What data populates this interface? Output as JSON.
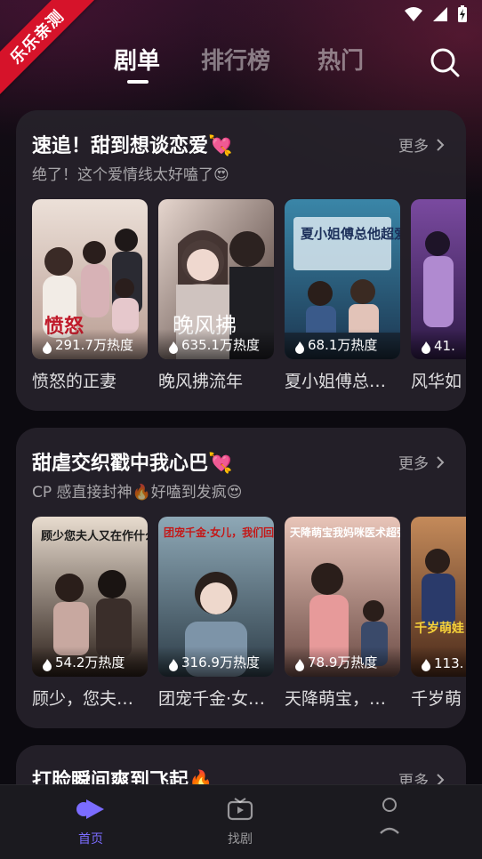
{
  "ribbon": {
    "label": "乐乐亲测"
  },
  "topnav": {
    "tabs": [
      {
        "label": "剧单",
        "active": true
      },
      {
        "label": "排行榜",
        "active": false
      },
      {
        "label": "热门",
        "active": false
      }
    ],
    "search_icon": "search-icon"
  },
  "sections": [
    {
      "title": "速追！甜到想谈恋爱💘",
      "subtitle": "绝了！这个爱情线太好嗑了😍",
      "more_label": "更多",
      "items": [
        {
          "title": "愤怒的正妻",
          "heat": "291.7万热度",
          "poster_text": "愤怒",
          "colors": [
            "#e9d9cf",
            "#b79a8f"
          ]
        },
        {
          "title": "晚风拂流年",
          "heat": "635.1万热度",
          "poster_text": "晚风拂",
          "colors": [
            "#d9c6bf",
            "#4a3a38"
          ]
        },
        {
          "title": "夏小姐傅总…",
          "heat": "68.1万热度",
          "poster_text": "夏小姐傅总他超爱",
          "colors": [
            "#2f6f8c",
            "#1d3a52"
          ]
        },
        {
          "title": "风华如",
          "heat": "41.",
          "poster_text": "",
          "colors": [
            "#6a3a8a",
            "#3a1e52"
          ]
        }
      ]
    },
    {
      "title": "甜虐交织戳中我心巴💘",
      "subtitle": "CP 感直接封神🔥好嗑到发疯😍",
      "more_label": "更多",
      "items": [
        {
          "title": "顾少，您夫…",
          "heat": "54.2万热度",
          "poster_text": "顾少您夫人又在作什么",
          "colors": [
            "#5a4436",
            "#2a201c"
          ]
        },
        {
          "title": "团宠千金·女…",
          "heat": "316.9万热度",
          "poster_text": "团宠千金·女儿，我们回家",
          "colors": [
            "#6a8a9a",
            "#2d3d48"
          ]
        },
        {
          "title": "天降萌宝，…",
          "heat": "78.9万热度",
          "poster_text": "天降萌宝我妈咪医术超强",
          "colors": [
            "#c98a7a",
            "#6a4a44"
          ]
        },
        {
          "title": "千岁萌",
          "heat": "113.",
          "poster_text": "千岁萌娃",
          "colors": [
            "#b06a3a",
            "#4a2a1a"
          ]
        }
      ]
    },
    {
      "title": "打脸瞬间爽到飞起🔥",
      "more_label": "更多"
    }
  ],
  "bottom_nav": [
    {
      "label": "首页",
      "active": true,
      "icon": "home-play-icon"
    },
    {
      "label": "找剧",
      "active": false,
      "icon": "tv-icon"
    },
    {
      "label": "",
      "active": false,
      "icon": "profile-icon"
    }
  ],
  "colors": {
    "accent": "#7b6cff",
    "ribbon": "#d6132a"
  }
}
